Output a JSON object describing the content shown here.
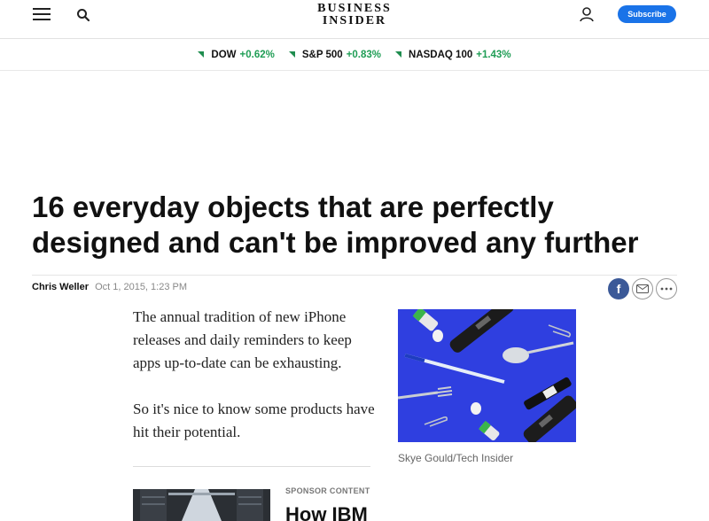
{
  "header": {
    "logo_line1": "BUSINESS",
    "logo_line2": "INSIDER",
    "subscribe_label": "Subscribe"
  },
  "ticker": [
    {
      "name": "DOW",
      "change": "+0.62%"
    },
    {
      "name": "S&P 500",
      "change": "+0.83%"
    },
    {
      "name": "NASDAQ 100",
      "change": "+1.43%"
    }
  ],
  "article": {
    "headline": "16 everyday objects that are perfectly designed and can't be improved any further",
    "author": "Chris Weller",
    "date": "Oct 1, 2015, 1:23 PM",
    "paragraphs": [
      "The annual tradition of new iPhone releases and daily reminders to keep apps up-to-date can be exhausting.",
      "So it's nice to know some products have hit their potential."
    ],
    "image_caption": "Skye Gould/Tech Insider"
  },
  "share": {
    "facebook_glyph": "f"
  },
  "sponsor": {
    "label": "SPONSOR CONTENT",
    "title": "How IBM"
  },
  "colors": {
    "accent": "#1a73e8",
    "positive": "#1f9d55",
    "facebook": "#3b5998",
    "hero_bg": "#2f3fe0"
  }
}
